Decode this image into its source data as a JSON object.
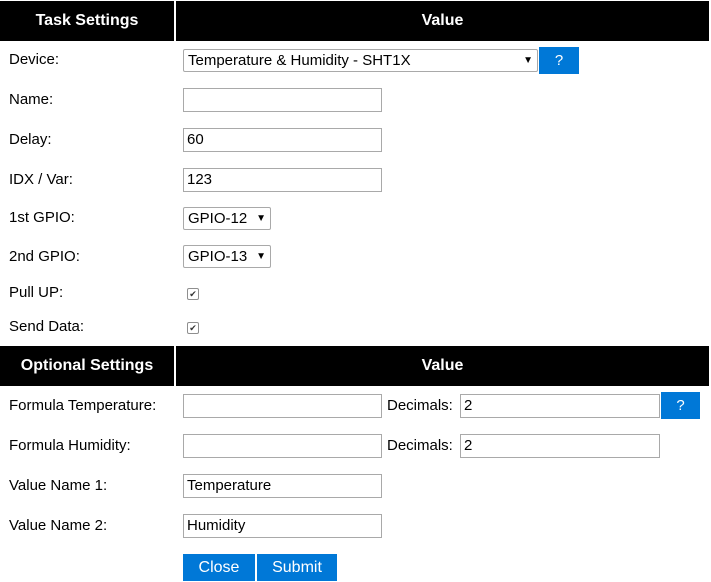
{
  "task_header": {
    "col1": "Task Settings",
    "col2": "Value"
  },
  "device": {
    "label": "Device:",
    "value": "Temperature & Humidity - SHT1X",
    "help": "?"
  },
  "name": {
    "label": "Name:",
    "value": ""
  },
  "delay": {
    "label": "Delay:",
    "value": "60"
  },
  "idx": {
    "label": "IDX / Var:",
    "value": "123"
  },
  "gpio1": {
    "label": "1st GPIO:",
    "value": "GPIO-12"
  },
  "gpio2": {
    "label": "2nd GPIO:",
    "value": "GPIO-13"
  },
  "pullup": {
    "label": "Pull UP:",
    "checked": true
  },
  "senddata": {
    "label": "Send Data:",
    "checked": true
  },
  "optional_header": {
    "col1": "Optional Settings",
    "col2": "Value"
  },
  "formula_temp": {
    "label": "Formula Temperature:",
    "value": "",
    "decimals_label": "Decimals:",
    "decimals": "2",
    "help": "?"
  },
  "formula_hum": {
    "label": "Formula Humidity:",
    "value": "",
    "decimals_label": "Decimals:",
    "decimals": "2"
  },
  "valname1": {
    "label": "Value Name 1:",
    "value": "Temperature"
  },
  "valname2": {
    "label": "Value Name 2:",
    "value": "Humidity"
  },
  "buttons": {
    "close": "Close",
    "submit": "Submit"
  },
  "icons": {
    "check": "checkmark-icon",
    "dropdown": "dropdown-arrow-icon"
  },
  "colors": {
    "header_bg": "#000000",
    "accent": "#0078d7"
  }
}
